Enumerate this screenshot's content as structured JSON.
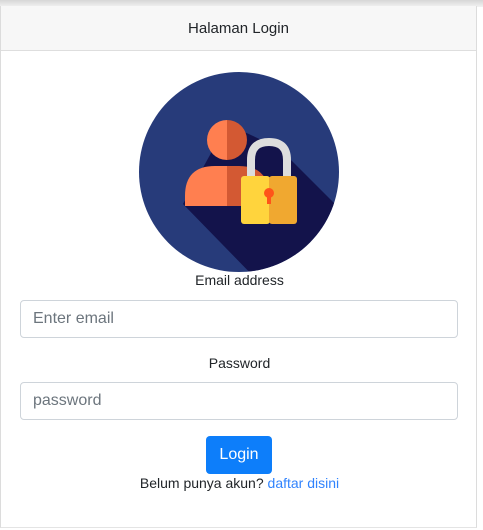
{
  "header": {
    "title": "Halaman Login"
  },
  "illustration": {
    "icon": "user-lock-icon",
    "colors": {
      "circle": "#273b7a",
      "shadow": "#121149",
      "person_light": "#ff7f50",
      "person_dark": "#d35933",
      "lock_shackle": "#dddddd",
      "lock_body_light": "#ffd43d",
      "lock_body_dark": "#f0a830",
      "keyhole": "#ff5419"
    }
  },
  "form": {
    "email_label": "Email address",
    "email_placeholder": "Enter email",
    "email_value": "",
    "password_label": "Password",
    "password_placeholder": "password",
    "password_value": "",
    "submit_label": "Login"
  },
  "register": {
    "prompt": "Belum punya akun?",
    "link_label": "daftar disini"
  },
  "colors": {
    "primary": "#0d7efa",
    "link": "#0d6efd"
  }
}
